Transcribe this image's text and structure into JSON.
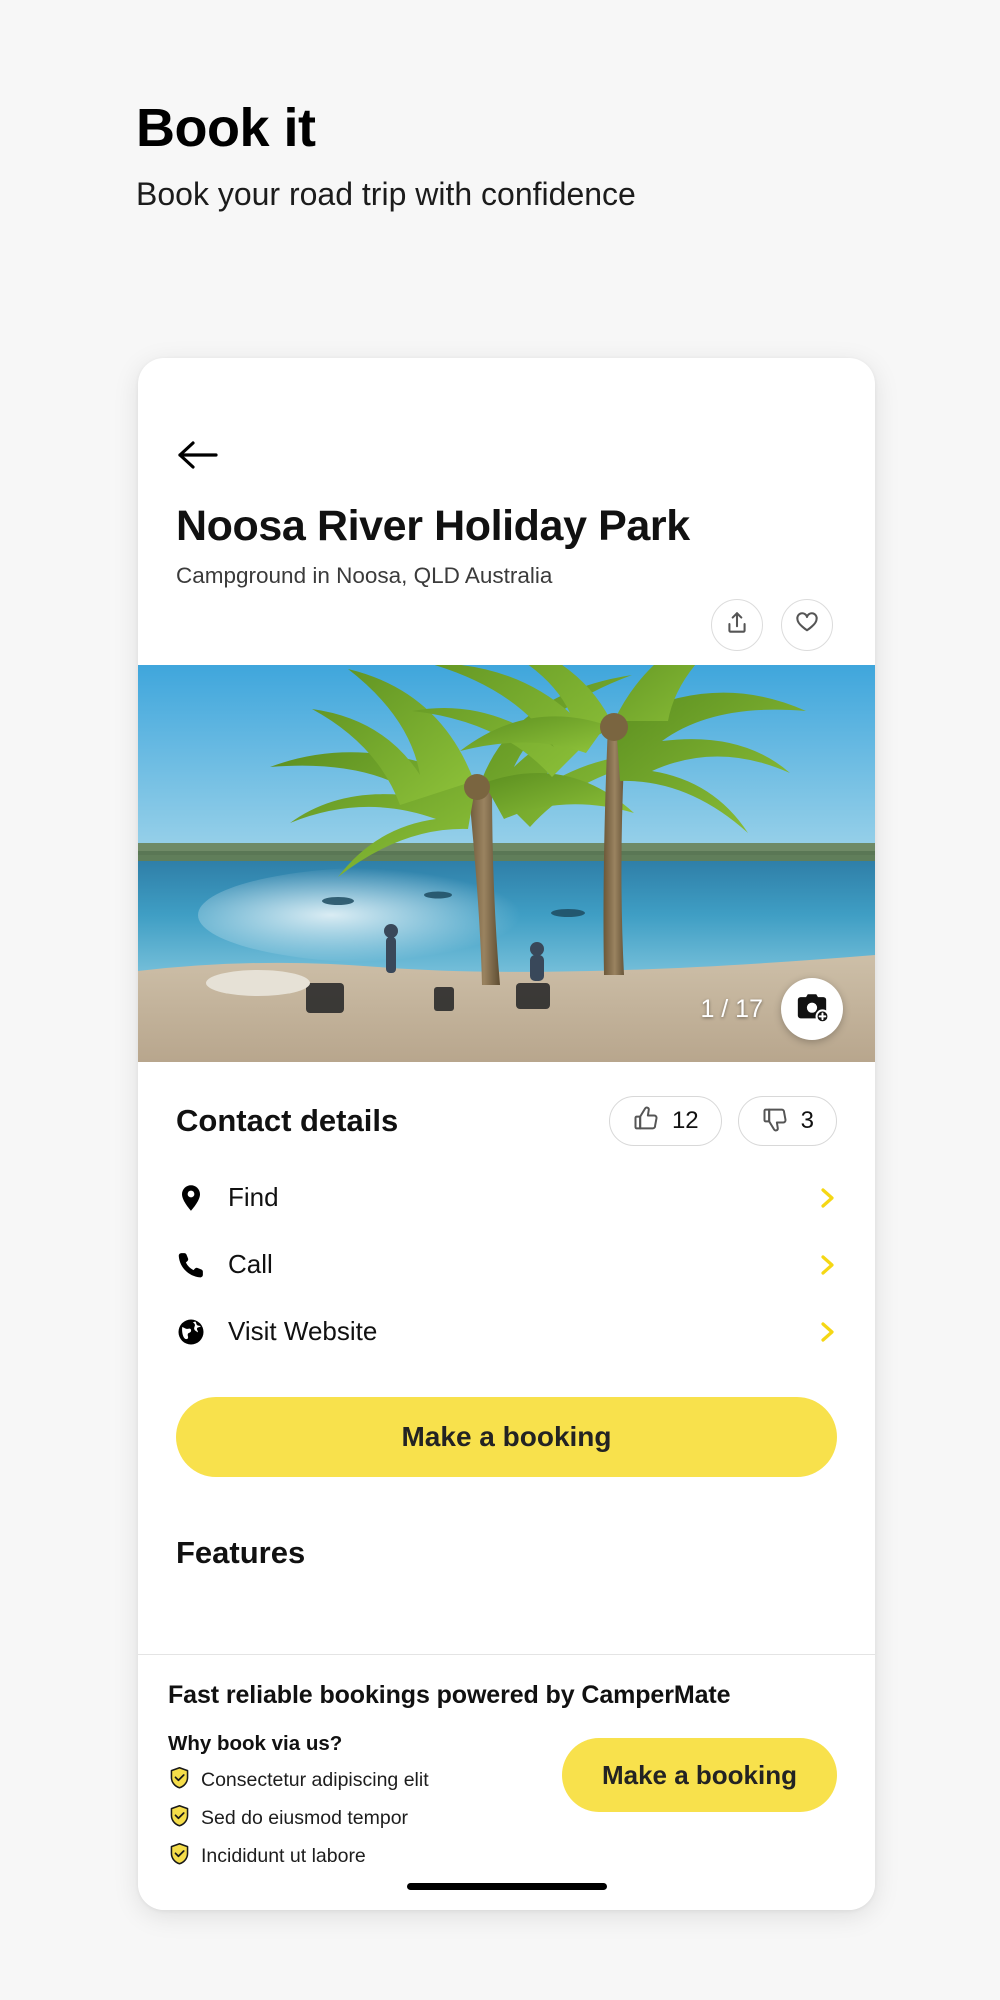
{
  "page": {
    "title": "Book it",
    "subtitle": "Book your road trip with confidence"
  },
  "detail": {
    "back_icon": "arrow-left-icon",
    "place_title": "Noosa River Holiday Park",
    "place_subtitle": "Campground in Noosa, QLD Australia",
    "share_icon": "share-upload-icon",
    "favorite_icon": "heart-outline-icon",
    "photo_counter": "1 / 17",
    "camera_icon": "camera-add-icon"
  },
  "contact": {
    "heading": "Contact details",
    "votes": {
      "up_icon": "thumbs-up-icon",
      "up_count": "12",
      "down_icon": "thumbs-down-icon",
      "down_count": "3"
    },
    "rows": [
      {
        "icon": "map-pin-icon",
        "label": "Find",
        "chevron": "chevron-right-icon"
      },
      {
        "icon": "phone-icon",
        "label": "Call",
        "chevron": "chevron-right-icon"
      },
      {
        "icon": "globe-icon",
        "label": "Visit Website",
        "chevron": "chevron-right-icon"
      }
    ],
    "book_label": "Make a booking"
  },
  "features": {
    "heading": "Features"
  },
  "banner": {
    "title": "Fast reliable bookings powered by CamperMate",
    "why_label": "Why book via us?",
    "benefits": [
      {
        "icon": "shield-check-icon",
        "text": "Consectetur adipiscing elit"
      },
      {
        "icon": "shield-check-icon",
        "text": "Sed do eiusmod tempor"
      },
      {
        "icon": "shield-check-icon",
        "text": "Incididunt ut labore"
      }
    ],
    "cta_label": "Make a booking"
  },
  "colors": {
    "accent_yellow": "#f8e14c",
    "page_bg": "#f7f7f7",
    "card_bg": "#ffffff",
    "text_primary": "#111111",
    "text_secondary": "#3b3b3b"
  }
}
